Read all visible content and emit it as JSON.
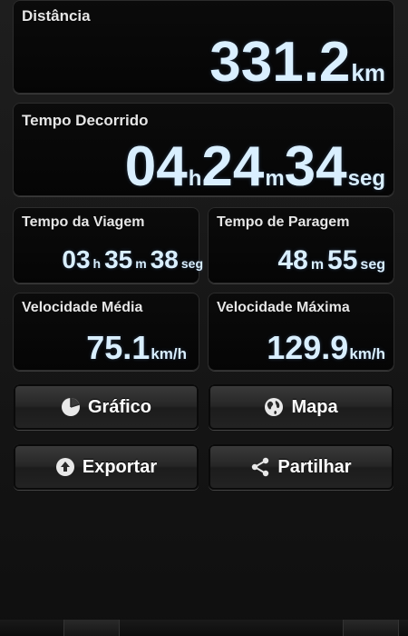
{
  "distance": {
    "label": "Distância",
    "value": "331.2",
    "unit": "km"
  },
  "elapsed": {
    "label": "Tempo Decorrido",
    "hours": "04",
    "hours_unit": "h",
    "minutes": "24",
    "minutes_unit": "m",
    "seconds": "34",
    "seconds_unit": "seg"
  },
  "trip_time": {
    "label": "Tempo da Viagem",
    "hours": "03",
    "hours_unit": "h",
    "minutes": "35",
    "minutes_unit": "m",
    "seconds": "38",
    "seconds_unit": "seg"
  },
  "stop_time": {
    "label": "Tempo de Paragem",
    "minutes": "48",
    "minutes_unit": "m",
    "seconds": "55",
    "seconds_unit": "seg"
  },
  "avg_speed": {
    "label": "Velocidade Média",
    "value": "75.1",
    "unit": "km/h"
  },
  "max_speed": {
    "label": "Velocidade Máxima",
    "value": "129.9",
    "unit": "km/h"
  },
  "buttons": {
    "chart": "Gráfico",
    "map": "Mapa",
    "export": "Exportar",
    "share": "Partilhar"
  },
  "icons": {
    "chart": "pie-chart-icon",
    "map": "globe-icon",
    "export": "upload-icon",
    "share": "share-icon"
  }
}
